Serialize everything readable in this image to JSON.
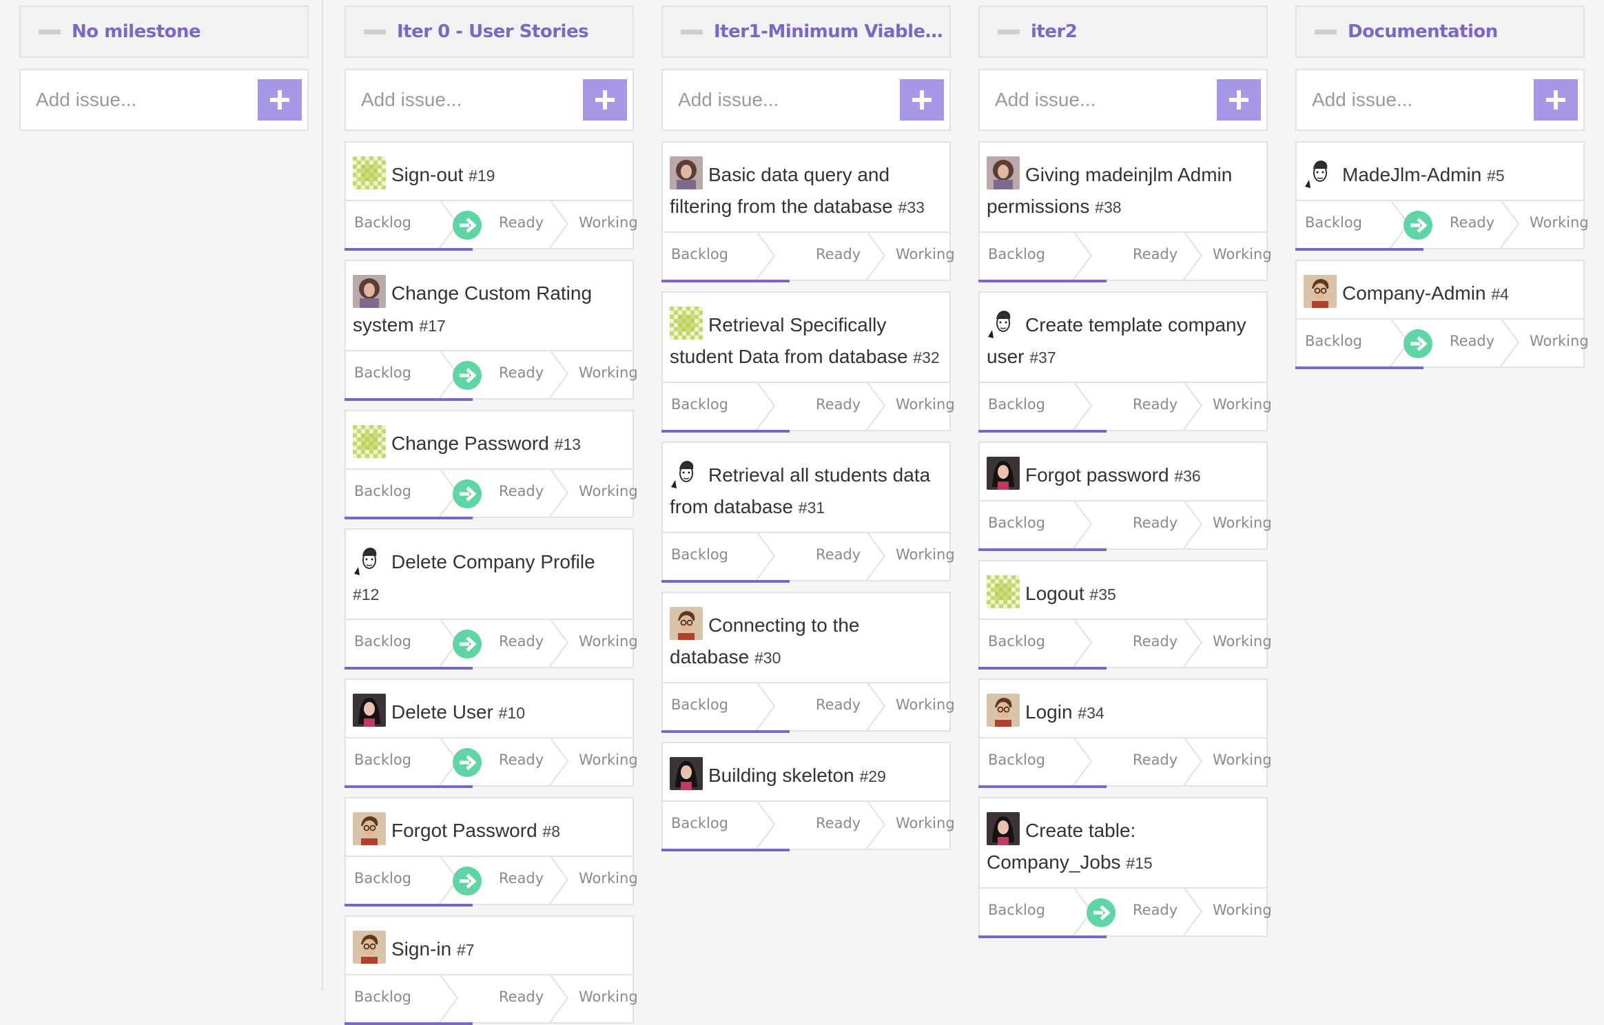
{
  "board": {
    "columns": [
      {
        "title": "No milestone",
        "add_placeholder": "Add issue...",
        "cards": []
      },
      {
        "title": "Iter 0 - User Stories",
        "add_placeholder": "Add issue...",
        "cards": [
          {
            "title": "Sign-out",
            "number": "#19",
            "avatar": "pattern",
            "move": true
          },
          {
            "title": "Change Custom Rating system",
            "number": "#17",
            "avatar": "woman-curly",
            "move": true
          },
          {
            "title": "Change Password",
            "number": "#13",
            "avatar": "pattern",
            "move": true
          },
          {
            "title": "Delete Company Profile",
            "number": "#12",
            "avatar": "man-sketch",
            "move": true
          },
          {
            "title": "Delete User",
            "number": "#10",
            "avatar": "woman-dark",
            "move": true
          },
          {
            "title": "Forgot Password",
            "number": "#8",
            "avatar": "man-glasses",
            "move": true
          },
          {
            "title": "Sign-in",
            "number": "#7",
            "avatar": "man-glasses",
            "move": false
          }
        ]
      },
      {
        "title": "Iter1-Minimum Viable P...",
        "add_placeholder": "Add issue...",
        "cards": [
          {
            "title": "Basic data query and filtering from the database",
            "number": "#33",
            "avatar": "woman-curly",
            "move": false
          },
          {
            "title": "Retrieval Specifically student Data from database",
            "number": "#32",
            "avatar": "pattern",
            "move": false
          },
          {
            "title": "Retrieval all students data from database",
            "number": "#31",
            "avatar": "man-sketch",
            "move": false
          },
          {
            "title": "Connecting to the database",
            "number": "#30",
            "avatar": "man-glasses",
            "move": false
          },
          {
            "title": "Building skeleton",
            "number": "#29",
            "avatar": "woman-dark",
            "move": false
          }
        ]
      },
      {
        "title": "iter2",
        "add_placeholder": "Add issue...",
        "cards": [
          {
            "title": "Giving madeinjlm Admin permissions",
            "number": "#38",
            "avatar": "woman-curly",
            "move": false
          },
          {
            "title": "Create template company user",
            "number": "#37",
            "avatar": "man-sketch",
            "move": false
          },
          {
            "title": "Forgot password",
            "number": "#36",
            "avatar": "woman-dark",
            "move": false
          },
          {
            "title": "Logout",
            "number": "#35",
            "avatar": "pattern",
            "move": false
          },
          {
            "title": "Login",
            "number": "#34",
            "avatar": "man-glasses",
            "move": false
          },
          {
            "title": "Create table: Company_Jobs",
            "number": "#15",
            "avatar": "woman-dark",
            "move": true
          }
        ]
      },
      {
        "title": "Documentation",
        "add_placeholder": "Add issue...",
        "cards": [
          {
            "title": "MadeJlm-Admin",
            "number": "#5",
            "avatar": "man-sketch",
            "move": true
          },
          {
            "title": "Company-Admin",
            "number": "#4",
            "avatar": "man-glasses",
            "move": true
          }
        ]
      }
    ],
    "stages": {
      "backlog": "Backlog",
      "ready": "Ready",
      "working": "Working"
    }
  },
  "colors": {
    "accent": "#7b68c6",
    "add_button": "#a896e6",
    "move_button": "#5fd4a4"
  }
}
